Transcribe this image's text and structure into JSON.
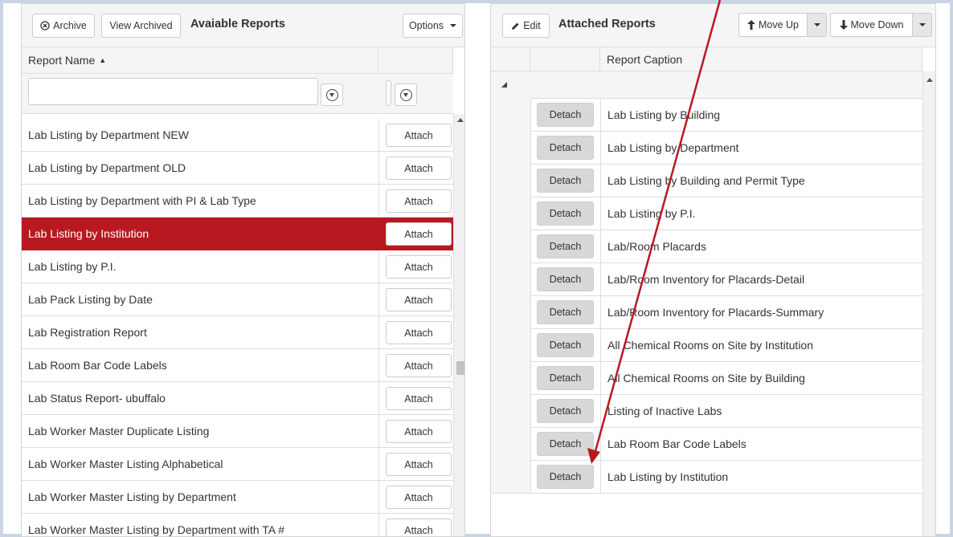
{
  "left": {
    "archive_label": "Archive",
    "view_archived_label": "View Archived",
    "title": "Avaiable Reports",
    "options_label": "Options",
    "column_header": "Report Name",
    "sort_indicator": "▲",
    "attach_label": "Attach",
    "selected_index": 3,
    "rows": [
      "Lab Listing by Department NEW",
      "Lab Listing by Department OLD",
      "Lab Listing by Department with PI & Lab Type",
      "Lab Listing by Institution",
      "Lab Listing by P.I.",
      "Lab Pack Listing by Date",
      "Lab Registration Report",
      "Lab Room Bar Code Labels",
      "Lab Status Report- ubuffalo",
      "Lab Worker Master Duplicate Listing",
      "Lab Worker Master Listing Alphabetical",
      "Lab Worker Master Listing by Department",
      "Lab Worker Master Listing by Department with TA #"
    ]
  },
  "right": {
    "edit_label": "Edit",
    "title": "Attached Reports",
    "move_up_label": "Move Up",
    "move_down_label": "Move Down",
    "column_header": "Report Caption",
    "detach_label": "Detach",
    "rows": [
      "Lab Listing by Building",
      "Lab Listing by Department",
      "Lab Listing by Building and Permit Type",
      "Lab Listing by P.I.",
      "Lab/Room Placards",
      "Lab/Room Inventory for Placards-Detail",
      "Lab/Room Inventory for Placards-Summary",
      "All Chemical Rooms on Site by Institution",
      "All Chemical Rooms on Site by Building",
      "Listing of Inactive Labs",
      "Lab Room Bar Code Labels",
      "Lab Listing by Institution"
    ]
  },
  "colors": {
    "selected_row": "#b81920",
    "annotation_arrow": "#b81920",
    "frame": "#c9d4e4"
  },
  "icons": {
    "archive": "circle-x-icon",
    "edit": "pencil-icon",
    "move_up": "arrow-up-icon",
    "move_down": "arrow-down-icon",
    "filter": "filter-icon"
  }
}
